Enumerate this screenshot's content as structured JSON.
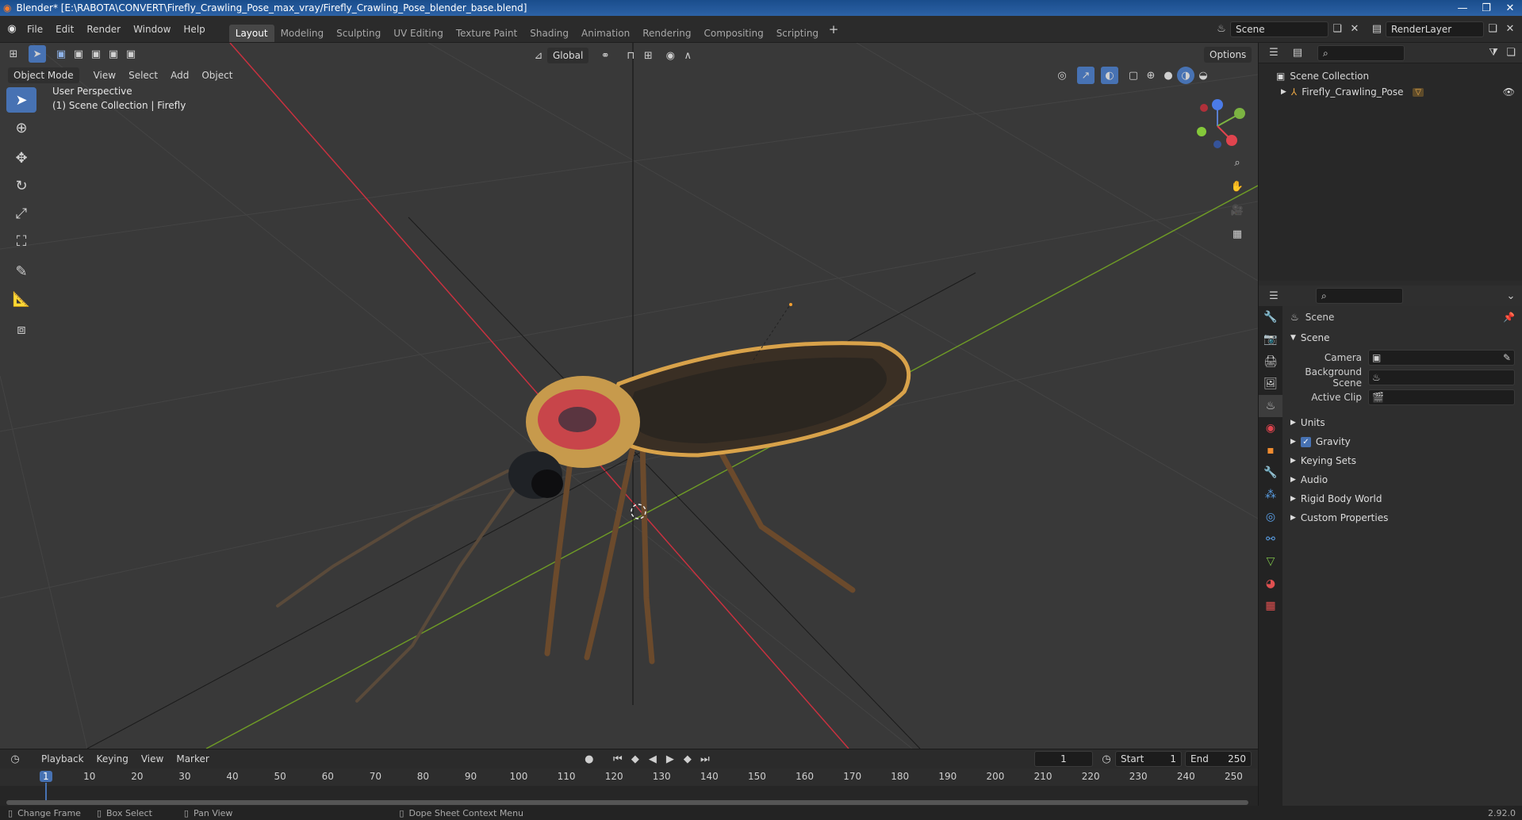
{
  "window": {
    "title": "Blender* [E:\\RABOTA\\CONVERT\\Firefly_Crawling_Pose_max_vray/Firefly_Crawling_Pose_blender_base.blend]",
    "minimize": "—",
    "maximize": "❐",
    "close": "✕"
  },
  "menus": [
    "File",
    "Edit",
    "Render",
    "Window",
    "Help"
  ],
  "workspaces": [
    "Layout",
    "Modeling",
    "Sculpting",
    "UV Editing",
    "Texture Paint",
    "Shading",
    "Animation",
    "Rendering",
    "Compositing",
    "Scripting"
  ],
  "scene_name": "Scene",
  "view_layer": "RenderLayer",
  "viewport": {
    "mode": "Object Mode",
    "menus": [
      "View",
      "Select",
      "Add",
      "Object"
    ],
    "transform_orientation": "Global",
    "options_label": "Options",
    "perspective_label": "User Perspective",
    "collection_label": "(1) Scene Collection | Firefly"
  },
  "outliner": {
    "root": "Scene Collection",
    "items": [
      "Firefly_Crawling_Pose"
    ]
  },
  "properties": {
    "context_title": "Scene",
    "panel_title": "Scene",
    "fields": [
      {
        "label": "Camera"
      },
      {
        "label": "Background Scene"
      },
      {
        "label": "Active Clip"
      }
    ],
    "subpanels": [
      "Units",
      "Gravity",
      "Keying Sets",
      "Audio",
      "Rigid Body World",
      "Custom Properties"
    ]
  },
  "timeline": {
    "menus": [
      "Playback",
      "Keying",
      "View",
      "Marker"
    ],
    "current_frame": "1",
    "start_label": "Start",
    "start_value": "1",
    "end_label": "End",
    "end_value": "250",
    "ticks": [
      "1",
      "10",
      "20",
      "30",
      "40",
      "50",
      "60",
      "70",
      "80",
      "90",
      "100",
      "110",
      "120",
      "130",
      "140",
      "150",
      "160",
      "170",
      "180",
      "190",
      "200",
      "210",
      "220",
      "230",
      "240",
      "250"
    ]
  },
  "status": {
    "items": [
      "Change Frame",
      "Box Select",
      "Pan View",
      "Dope Sheet Context Menu"
    ],
    "version": "2.92.0"
  },
  "colors": {
    "accent": "#4772b3",
    "x_axis": "#c9313f",
    "y_axis": "#6e9a26"
  }
}
